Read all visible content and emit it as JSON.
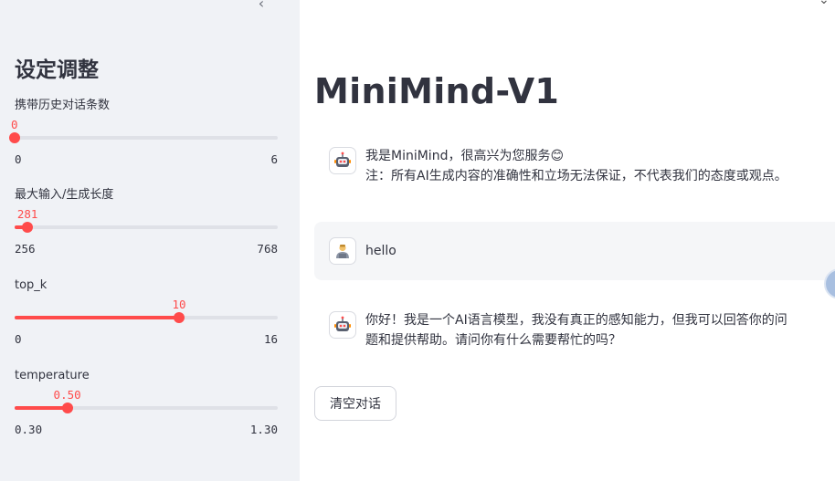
{
  "sidebar": {
    "title": "设定调整",
    "collapse_icon": "chevron-left-icon",
    "sliders": [
      {
        "label": "携带历史对话条数",
        "value": "0",
        "min": "0",
        "max": "6",
        "fraction": 0.0
      },
      {
        "label": "最大输入/生成长度",
        "value": "281",
        "min": "256",
        "max": "768",
        "fraction": 0.049
      },
      {
        "label": "top_k",
        "value": "10",
        "min": "0",
        "max": "16",
        "fraction": 0.625
      },
      {
        "label": "temperature",
        "value": "0.50",
        "min": "0.30",
        "max": "1.30",
        "fraction": 0.2
      }
    ]
  },
  "main": {
    "title": "MiniMind-V1",
    "messages": [
      {
        "role": "assistant",
        "avatar": "robot-icon",
        "lines": [
          "我是MiniMind，很高兴为您服务😊",
          "注：所有AI生成内容的准确性和立场无法保证，不代表我们的态度或观点。"
        ]
      },
      {
        "role": "user",
        "avatar": "user-icon",
        "lines": [
          "hello"
        ]
      },
      {
        "role": "assistant",
        "avatar": "robot-icon",
        "lines": [
          "你好！我是一个AI语言模型，我没有真正的感知能力，但我可以回答你的问",
          "题和提供帮助。请问你有什么需要帮忙的吗？"
        ]
      }
    ],
    "clear_button": "清空对话"
  },
  "colors": {
    "accent": "#ff4b4b",
    "sidebar_bg": "#f0f2f6",
    "track": "#dfe1e7",
    "user_msg_bg": "#f5f6f8"
  }
}
